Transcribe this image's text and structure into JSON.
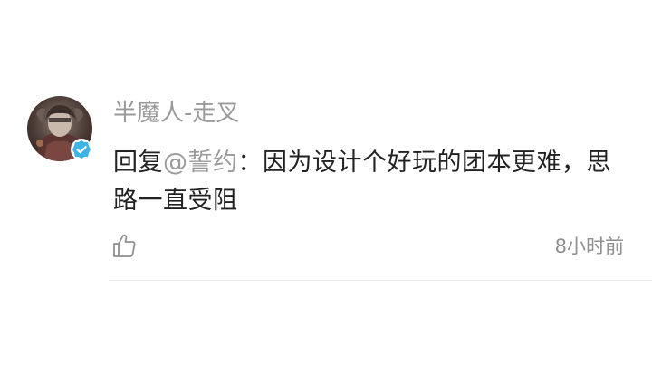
{
  "comment": {
    "username": "半魔人-走叉",
    "reply_prefix": "回复",
    "mention": "@誓约",
    "content": "：因为设计个好玩的团本更难，思路一直受阻",
    "timestamp": "8小时前",
    "verified": true
  },
  "icons": {
    "avatar": "user-avatar",
    "verified_badge": "verified-check-icon",
    "like": "thumbs-up-icon"
  },
  "colors": {
    "username": "#9a9a9a",
    "mention": "#9a9a9a",
    "text": "#222222",
    "verified": "#3cb4e6"
  }
}
